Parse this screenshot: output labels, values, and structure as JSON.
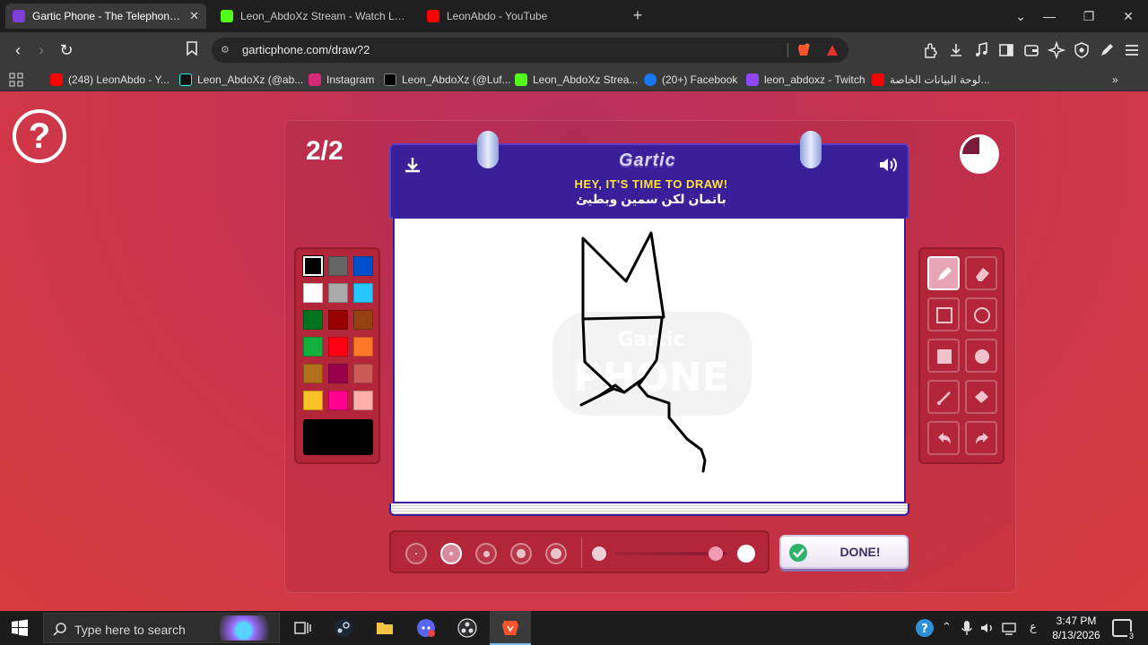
{
  "browser": {
    "tabs": [
      {
        "title": "Gartic Phone - The Telephone Ga",
        "active": true,
        "favicon_color": "#7b3fd8"
      },
      {
        "title": "Leon_AbdoXz Stream - Watch Live on",
        "active": false,
        "favicon_color": "#53fc18"
      },
      {
        "title": "LeonAbdo - YouTube",
        "active": false,
        "favicon_color": "#ff0000"
      }
    ],
    "new_tab": "+",
    "url": "garticphone.com/draw?2",
    "bookmarks": [
      {
        "label": "(248) LeonAbdo - Y...",
        "icon": "youtube-icon",
        "color": "#ff0000"
      },
      {
        "label": "Leon_AbdoXz (@ab...",
        "icon": "tiktok-icon",
        "color": "#000000"
      },
      {
        "label": "Instagram",
        "icon": "instagram-icon",
        "color": "#d62976"
      },
      {
        "label": "Leon_AbdoXz (@Luf...",
        "icon": "x-icon",
        "color": "#000000"
      },
      {
        "label": "Leon_AbdoXz Strea...",
        "icon": "kick-icon",
        "color": "#53fc18"
      },
      {
        "label": "(20+) Facebook",
        "icon": "facebook-icon",
        "color": "#1877f2"
      },
      {
        "label": "leon_abdoxz - Twitch",
        "icon": "twitch-icon",
        "color": "#9146ff"
      },
      {
        "label": "لوحة البيانات الخاصة...",
        "icon": "youtube-icon",
        "color": "#ff0000"
      }
    ]
  },
  "game": {
    "round": "2/2",
    "logo": "Gartic",
    "prompt_title": "HEY, IT'S TIME TO DRAW!",
    "prompt": "باتمان لكن سمين وبطيئ",
    "timer_remaining": 0.25,
    "palette": [
      "#000000",
      "#666666",
      "#0050cd",
      "#ffffff",
      "#aaaaaa",
      "#26c9ff",
      "#017420",
      "#990000",
      "#964112",
      "#11b03c",
      "#ff0013",
      "#ff7829",
      "#b0701c",
      "#99004e",
      "#cb5a57",
      "#ffc126",
      "#ff008f",
      "#feafa8"
    ],
    "selected_color": "#000000",
    "tools": [
      "pencil",
      "eraser",
      "rect-outline",
      "circle-outline",
      "rect-filled",
      "circle-filled",
      "line",
      "fill-bucket",
      "undo",
      "redo"
    ],
    "selected_tool": "pencil",
    "brush_sizes_count": 5,
    "selected_brush_index": 1,
    "opacity": 0.9,
    "done_label": "DONE!"
  },
  "taskbar": {
    "search_placeholder": "Type here to search",
    "time": "3:47 PM",
    "date": "8/13/2026",
    "language": "ع",
    "notifications": "3"
  }
}
